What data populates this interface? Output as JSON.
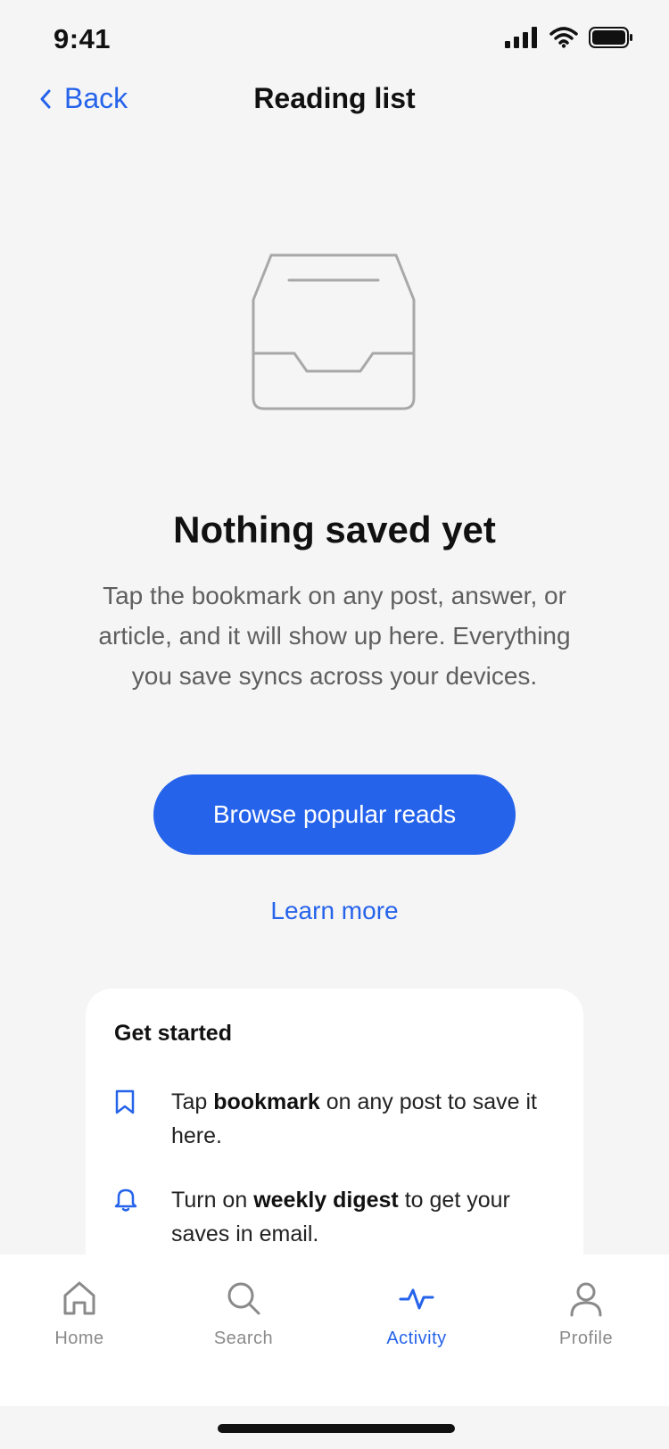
{
  "status_bar": {
    "time": "9:41"
  },
  "nav": {
    "back_label": "Back",
    "title": "Reading list"
  },
  "empty_state": {
    "title": "Nothing saved yet",
    "description": "Tap the bookmark on any post, answer, or article, and it will show up here. Everything you save syncs across your devices.",
    "primary_button": "Browse popular reads",
    "secondary_link": "Learn more"
  },
  "get_started": {
    "title": "Get started",
    "tips": [
      {
        "icon": "bookmark-icon",
        "before": "Tap ",
        "bold": "bookmark",
        "after": " on any post to save it here."
      },
      {
        "icon": "bell-icon",
        "before": "Turn on ",
        "bold": "weekly digest",
        "after": " to get your saves in email."
      }
    ]
  },
  "tabs": [
    {
      "label": "Home",
      "icon": "home-icon"
    },
    {
      "label": "Search",
      "icon": "search-icon"
    },
    {
      "label": "Activity",
      "icon": "activity-icon",
      "active": true
    },
    {
      "label": "Profile",
      "icon": "profile-icon"
    }
  ],
  "colors": {
    "accent": "#2563eb",
    "background": "#f5f5f5",
    "muted": "#8a8a8a"
  }
}
